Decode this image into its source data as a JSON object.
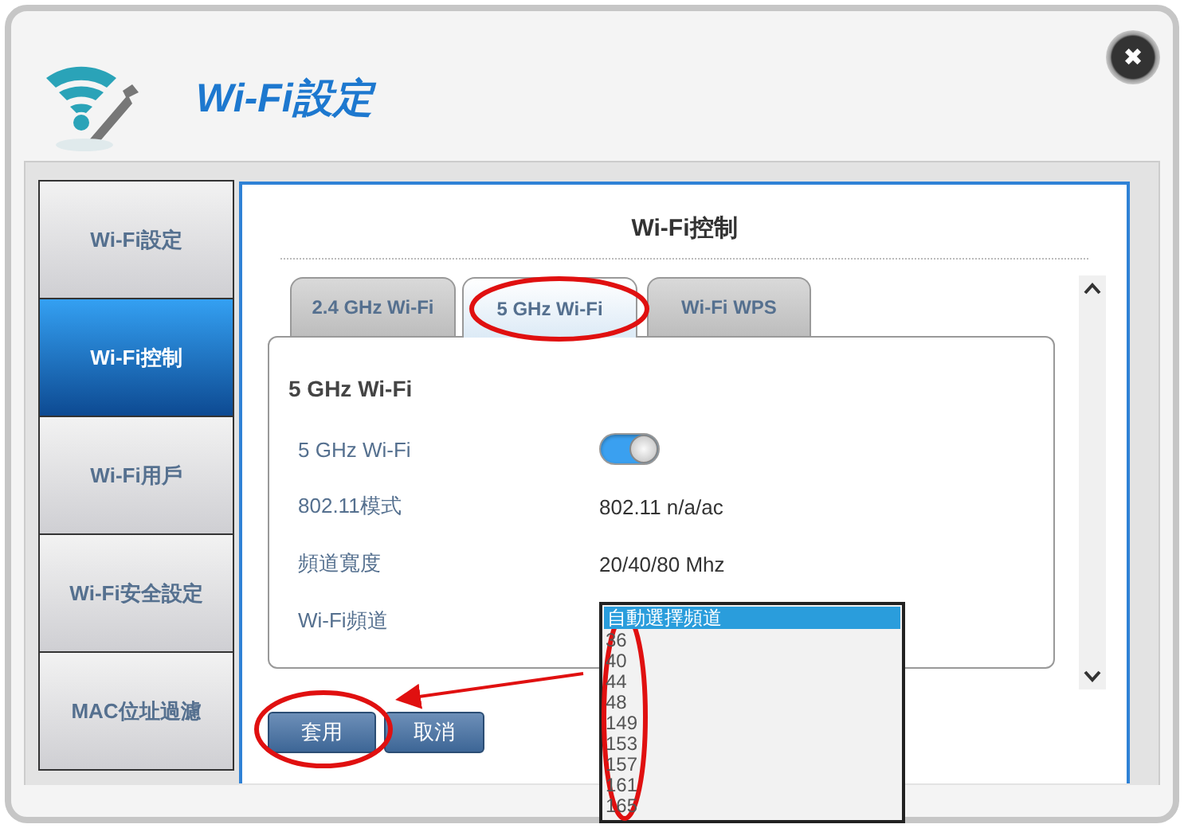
{
  "window": {
    "title": "Wi-Fi設定",
    "close": "✖"
  },
  "sidebar": {
    "items": [
      {
        "label": "Wi-Fi設定",
        "selected": false
      },
      {
        "label": "Wi-Fi控制",
        "selected": true
      },
      {
        "label": "Wi-Fi用戶",
        "selected": false
      },
      {
        "label": "Wi-Fi安全設定",
        "selected": false
      },
      {
        "label": "MAC位址過濾",
        "selected": false
      }
    ]
  },
  "panel": {
    "title": "Wi-Fi控制"
  },
  "tabs": [
    {
      "label": "2.4 GHz Wi-Fi",
      "selected": false
    },
    {
      "label": "5 GHz Wi-Fi",
      "selected": true
    },
    {
      "label": "Wi-Fi WPS",
      "selected": false
    }
  ],
  "section_title": "5 GHz Wi-Fi",
  "rows": [
    {
      "kind": "toggle",
      "label": "5 GHz Wi-Fi",
      "on": true
    },
    {
      "kind": "text",
      "label": "802.11模式",
      "value": "802.11 n/a/ac"
    },
    {
      "kind": "text",
      "label": "頻道寬度",
      "value": "20/40/80 Mhz"
    },
    {
      "kind": "select",
      "label": "Wi-Fi頻道"
    }
  ],
  "channel_options": [
    {
      "label": "自動選擇頻道",
      "selected": true
    },
    {
      "label": "36",
      "selected": false
    },
    {
      "label": "40",
      "selected": false
    },
    {
      "label": "44",
      "selected": false
    },
    {
      "label": "48",
      "selected": false
    },
    {
      "label": "149",
      "selected": false
    },
    {
      "label": "153",
      "selected": false
    },
    {
      "label": "157",
      "selected": false
    },
    {
      "label": "161",
      "selected": false
    },
    {
      "label": "165",
      "selected": false
    }
  ],
  "buttons": [
    "套用",
    "取消"
  ]
}
